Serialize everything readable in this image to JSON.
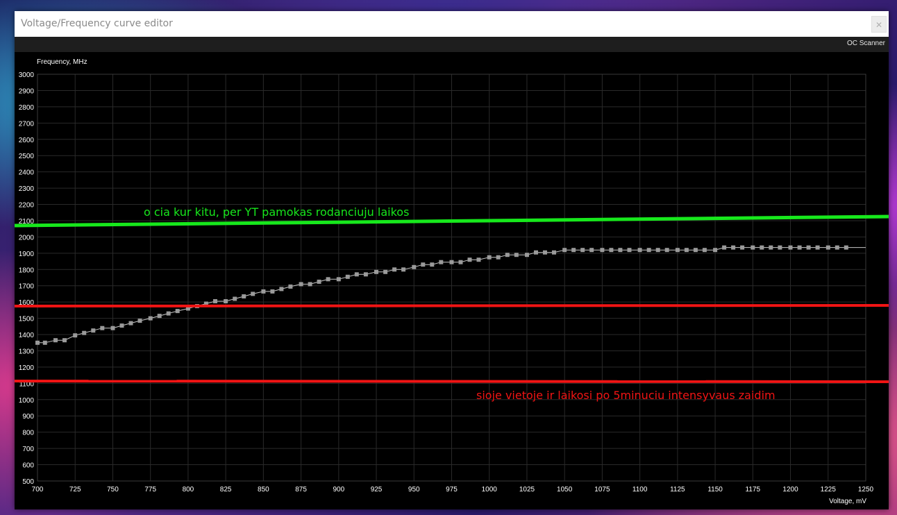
{
  "window": {
    "title": "Voltage/Frequency curve editor",
    "close_glyph": "✕"
  },
  "toolbar": {
    "oc_scanner_label": "OC Scanner"
  },
  "chart_data": {
    "type": "line",
    "ylabel": "Frequency, MHz",
    "xlabel": "Voltage, mV",
    "xlim": [
      700,
      1250
    ],
    "ylim": [
      500,
      3000
    ],
    "x_ticks": [
      700,
      725,
      750,
      775,
      800,
      825,
      850,
      875,
      900,
      925,
      950,
      975,
      1000,
      1025,
      1050,
      1075,
      1100,
      1125,
      1150,
      1175,
      1200,
      1225,
      1250
    ],
    "y_ticks": [
      500,
      600,
      700,
      800,
      900,
      1000,
      1100,
      1200,
      1300,
      1400,
      1500,
      1600,
      1700,
      1800,
      1900,
      2000,
      2100,
      2200,
      2300,
      2400,
      2500,
      2600,
      2700,
      2800,
      2900,
      3000
    ],
    "grid": true,
    "series": [
      {
        "color": "#c8c8c8",
        "marker_color": "#9a9a9a",
        "x": [
          700,
          705,
          712,
          718,
          725,
          731,
          737,
          743,
          750,
          756,
          762,
          768,
          775,
          781,
          787,
          793,
          800,
          806,
          812,
          818,
          825,
          831,
          837,
          843,
          850,
          856,
          862,
          868,
          875,
          881,
          887,
          893,
          900,
          906,
          912,
          918,
          925,
          931,
          937,
          943,
          950,
          956,
          962,
          968,
          975,
          981,
          987,
          993,
          1000,
          1006,
          1012,
          1018,
          1025,
          1031,
          1037,
          1043,
          1050,
          1056,
          1062,
          1068,
          1075,
          1081,
          1087,
          1093,
          1100,
          1106,
          1112,
          1118,
          1125,
          1131,
          1137,
          1143,
          1150,
          1156,
          1162,
          1168,
          1175,
          1181,
          1187,
          1193,
          1200,
          1206,
          1212,
          1218,
          1225,
          1231,
          1237
        ],
        "y": [
          1350,
          1350,
          1365,
          1365,
          1395,
          1410,
          1425,
          1440,
          1440,
          1455,
          1470,
          1485,
          1500,
          1515,
          1530,
          1545,
          1560,
          1575,
          1590,
          1605,
          1605,
          1620,
          1635,
          1650,
          1665,
          1665,
          1680,
          1695,
          1710,
          1710,
          1725,
          1740,
          1740,
          1755,
          1770,
          1770,
          1785,
          1785,
          1800,
          1800,
          1815,
          1830,
          1830,
          1845,
          1845,
          1845,
          1860,
          1860,
          1875,
          1875,
          1890,
          1890,
          1890,
          1905,
          1905,
          1905,
          1920,
          1920,
          1920,
          1920,
          1920,
          1920,
          1920,
          1920,
          1920,
          1920,
          1920,
          1920,
          1920,
          1920,
          1920,
          1920,
          1920,
          1935,
          1935,
          1935,
          1935,
          1935,
          1935,
          1935,
          1935,
          1935,
          1935,
          1935,
          1935,
          1935,
          1935
        ]
      }
    ]
  },
  "annotations": {
    "green_text": "o cia kur kitu, per YT pamokas rodanciuju laikos",
    "red_text": "sioje vietoje ir laikosi po 5minuciu intensyvaus zaidim",
    "green_color": "#17e81c",
    "red_color": "#f01414"
  }
}
